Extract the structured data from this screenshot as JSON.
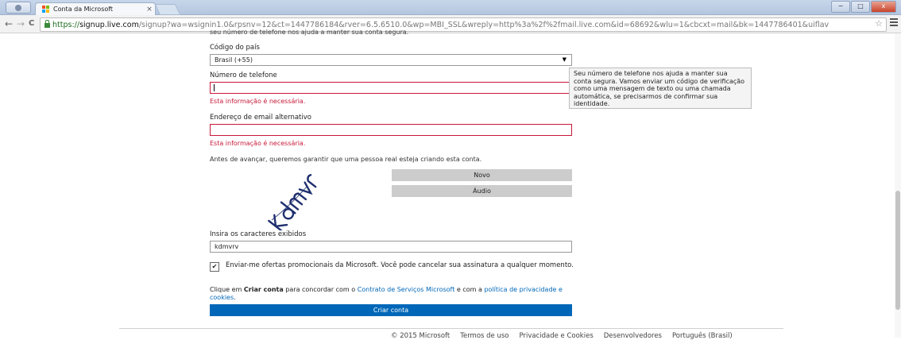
{
  "browser": {
    "tab_title": "Conta da Microsoft",
    "tab_close": "×",
    "url_scheme": "https://",
    "url_host": "signup.live.com",
    "url_path": "/signup?wa=wsignin1.0&rpsnv=12&ct=1447786184&rver=6.5.6510.0&wp=MBI_SSL&wreply=http%3a%2f%2fmail.live.com&id=68692&wlu=1&cbcxt=mail&bk=1447786401&uiflav",
    "back_icon": "←",
    "forward_icon": "→",
    "reload_icon": "C",
    "star_icon": "☆",
    "window_minimize": "−",
    "window_maximize": "□",
    "window_close": "x"
  },
  "form": {
    "cut_top_text": "seu número de telefone nos ajuda a manter sua conta segura.",
    "country_label": "Código do país",
    "country_value": "Brasil (+55)",
    "phone_label": "Número de telefone",
    "phone_value": "",
    "phone_error": "Esta informação é necessária.",
    "email_label": "Endereço de email alternativo",
    "email_value": "",
    "email_error": "Esta informação é necessária.",
    "captcha_intro": "Antes de avançar, queremos garantir que uma pessoa real esteja criando esta conta.",
    "captcha_new": "Novo",
    "captcha_audio": "Áudio",
    "captcha_input_label": "Insira os caracteres exibidos",
    "captcha_value": "kdmvrv",
    "offers_checked": true,
    "offers_text": "Enviar-me ofertas promocionais da Microsoft. Você pode cancelar sua assinatura a qualquer momento.",
    "terms_prefix": "Clique em",
    "terms_bold": "Criar conta",
    "terms_middle": "para concordar com o",
    "terms_link1": "Contrato de Serviços Microsoft",
    "terms_and": "e com a",
    "terms_link2": "política de privacidade e cookies",
    "terms_end": ".",
    "submit_label": "Criar conta"
  },
  "tooltip": {
    "text": "Seu número de telefone nos ajuda a manter sua conta segura. Vamos enviar um código de verificação como uma mensagem de texto ou uma chamada automática, se precisarmos de confirmar sua identidade."
  },
  "footer": {
    "copyright": "© 2015 Microsoft",
    "links": [
      "Termos de uso",
      "Privacidade e Cookies",
      "Desenvolvedores",
      "Português (Brasil)"
    ]
  },
  "colors": {
    "accent": "#0067b8",
    "error": "#c81838",
    "button_grey": "#cccccc"
  }
}
